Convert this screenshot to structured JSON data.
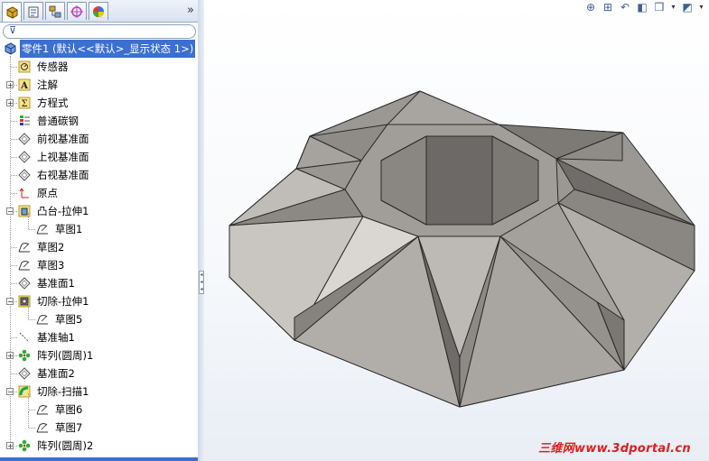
{
  "feature_tree": {
    "tabs": [
      "feature-manager-icon",
      "property-manager-icon",
      "configuration-manager-icon",
      "dimxpert-icon",
      "display-manager-icon"
    ],
    "more_symbol": "»",
    "filter_symbol": "⊽",
    "root_label": "零件1  (默认<<默认>_显示状态 1>)",
    "items": [
      {
        "label": "传感器",
        "icon": "sensor-icon",
        "expandable": false,
        "indent": 1
      },
      {
        "label": "注解",
        "icon": "annotation-icon",
        "expandable": true,
        "indent": 1
      },
      {
        "label": "方程式",
        "icon": "equation-icon",
        "expandable": true,
        "indent": 1
      },
      {
        "label": "普通碳钢",
        "icon": "material-icon",
        "expandable": false,
        "indent": 1
      },
      {
        "label": "前视基准面",
        "icon": "plane-icon",
        "expandable": false,
        "indent": 1
      },
      {
        "label": "上视基准面",
        "icon": "plane-icon",
        "expandable": false,
        "indent": 1
      },
      {
        "label": "右视基准面",
        "icon": "plane-icon",
        "expandable": false,
        "indent": 1
      },
      {
        "label": "原点",
        "icon": "origin-icon",
        "expandable": false,
        "indent": 1
      },
      {
        "label": "凸台-拉伸1",
        "icon": "boss-extrude-icon",
        "expandable": true,
        "indent": 1
      },
      {
        "label": "草图1",
        "icon": "sketch-icon",
        "expandable": false,
        "indent": 2
      },
      {
        "label": "草图2",
        "icon": "sketch-icon",
        "expandable": false,
        "indent": 1
      },
      {
        "label": "草图3",
        "icon": "sketch-icon",
        "expandable": false,
        "indent": 1
      },
      {
        "label": "基准面1",
        "icon": "plane-icon",
        "expandable": false,
        "indent": 1
      },
      {
        "label": "切除-拉伸1",
        "icon": "cut-extrude-icon",
        "expandable": true,
        "indent": 1
      },
      {
        "label": "草图5",
        "icon": "sketch-icon",
        "expandable": false,
        "indent": 2
      },
      {
        "label": "基准轴1",
        "icon": "axis-icon",
        "expandable": false,
        "indent": 1
      },
      {
        "label": "阵列(圆周)1",
        "icon": "circular-pattern-icon",
        "expandable": true,
        "indent": 1
      },
      {
        "label": "基准面2",
        "icon": "plane-icon",
        "expandable": false,
        "indent": 1
      },
      {
        "label": "切除-扫描1",
        "icon": "cut-sweep-icon",
        "expandable": true,
        "indent": 1
      },
      {
        "label": "草图6",
        "icon": "sketch-icon",
        "expandable": false,
        "indent": 2
      },
      {
        "label": "草图7",
        "icon": "sketch-icon",
        "expandable": false,
        "indent": 2
      },
      {
        "label": "阵列(圆周)2",
        "icon": "circular-pattern-icon",
        "expandable": true,
        "indent": 1
      }
    ]
  },
  "view_toolbar": [
    "zoom-to-fit-icon",
    "zoom-to-area-icon",
    "previous-view-icon",
    "section-view-icon",
    "view-orientation-icon",
    "dropdown-arrow",
    "display-style-icon",
    "dropdown-arrow"
  ],
  "watermark": "三维网www.3dportal.cn",
  "colors": {
    "selection": "#3b6fd0",
    "model_face": "#a9a6a2",
    "edge": "#2a2a2a"
  }
}
